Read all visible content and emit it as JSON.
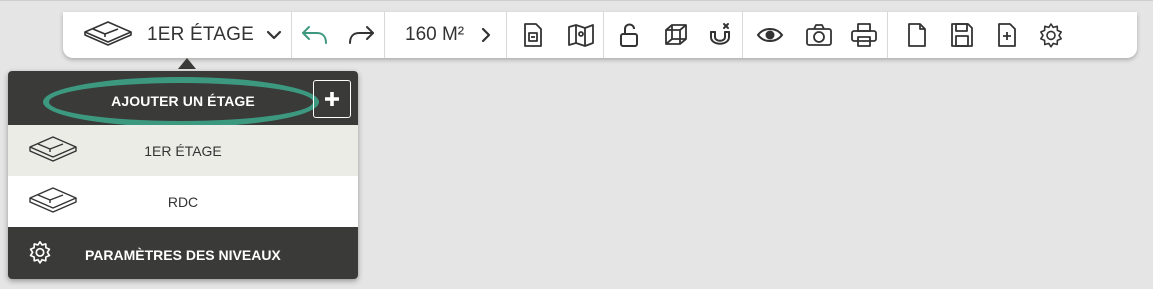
{
  "toolbar": {
    "floor_selector": {
      "label": "1ER ÉTAGE",
      "icon": "floor-plan-icon",
      "dropdown_icon": "chevron-down-icon"
    },
    "undo_icon": "undo-icon",
    "redo_icon": "redo-icon",
    "area": {
      "value": "160 M²",
      "icon": "chevron-right-icon"
    },
    "tools": [
      {
        "name": "document-icon"
      },
      {
        "name": "map-icon"
      },
      {
        "name": "unlock-icon"
      },
      {
        "name": "3d-cube-icon"
      },
      {
        "name": "magnet-icon"
      },
      {
        "name": "eye-icon"
      },
      {
        "name": "camera-icon"
      },
      {
        "name": "printer-icon"
      },
      {
        "name": "new-file-icon"
      },
      {
        "name": "save-icon"
      },
      {
        "name": "add-file-icon"
      },
      {
        "name": "gear-icon"
      }
    ]
  },
  "floor_menu": {
    "add_label": "AJOUTER UN ÉTAGE",
    "add_icon": "plus-icon",
    "floors": [
      {
        "label": "1ER ÉTAGE",
        "selected": true
      },
      {
        "label": "RDC",
        "selected": false
      }
    ],
    "settings_label": "PARAMÈTRES DES NIVEAUX",
    "settings_icon": "gear-icon"
  },
  "colors": {
    "accent": "#3d9880",
    "menu_dark": "#3a3a38",
    "selected_row": "#ecece6",
    "background": "#e5e5e5"
  }
}
